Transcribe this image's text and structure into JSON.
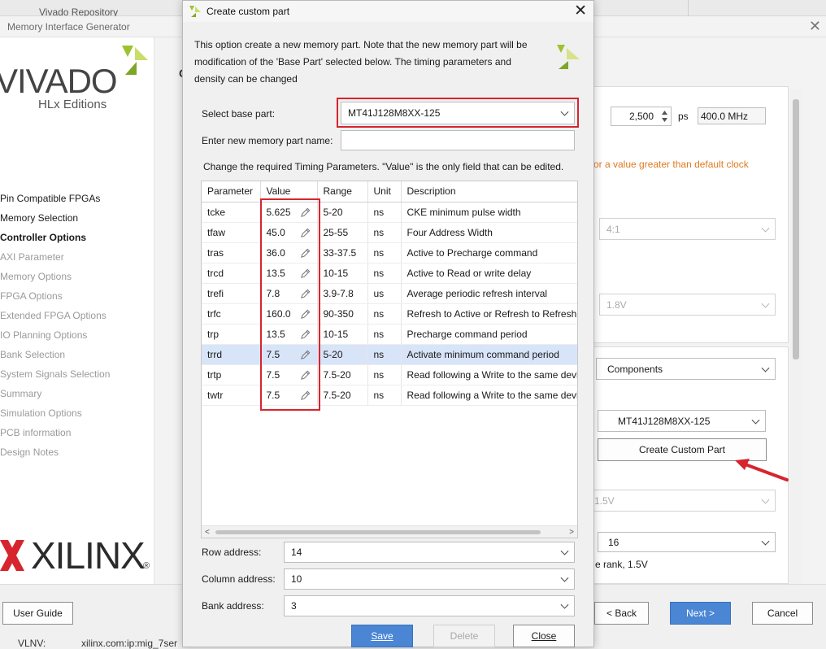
{
  "background": {
    "top_strip_text": "Vivado Repository",
    "window_title": "Memory Interface Generator",
    "brand": {
      "vivado": "VIVADO",
      "hlx": "HLx Editions",
      "xilinx": "XILINX",
      "reg": "®"
    },
    "nav_items": [
      {
        "label": "Pin Compatible FPGAs",
        "state": "active"
      },
      {
        "label": "Memory Selection",
        "state": "active"
      },
      {
        "label": "Controller Options",
        "state": "current"
      },
      {
        "label": "AXI Parameter",
        "state": "inactive"
      },
      {
        "label": "Memory Options",
        "state": "inactive"
      },
      {
        "label": "FPGA Options",
        "state": "inactive"
      },
      {
        "label": "Extended FPGA Options",
        "state": "inactive"
      },
      {
        "label": "IO Planning Options",
        "state": "inactive"
      },
      {
        "label": "Bank Selection",
        "state": "inactive"
      },
      {
        "label": "System Signals Selection",
        "state": "inactive"
      },
      {
        "label": "Summary",
        "state": "inactive"
      },
      {
        "label": "Simulation Options",
        "state": "inactive"
      },
      {
        "label": "PCB information",
        "state": "inactive"
      },
      {
        "label": "Design Notes",
        "state": "inactive"
      }
    ],
    "page_letter": "C",
    "clock_period": "2,500",
    "clock_unit": "ps",
    "clock_freq": "400.0 MHz",
    "clock_warning": "or a value greater than default clock",
    "ratio_value": "4:1",
    "voltage_value": "1.8V",
    "memory_type": "Components",
    "memory_part": "MT41J128M8XX-125",
    "create_custom_part_label": "Create Custom Part",
    "io_voltage": "1.5V",
    "data_width": "16",
    "rank_text": "e rank, 1.5V",
    "user_guide_label": "User Guide",
    "back_label": "< Back",
    "next_label": "Next >",
    "cancel_label": "Cancel",
    "vlnv_label": "VLNV:",
    "vlnv_value": "xilinx.com:ip:mig_7ser",
    "annotation_arrow_color": "#d6252e"
  },
  "dialog": {
    "title": "Create custom part",
    "description": "This option create a new memory part. Note that the new memory part will be modification of the 'Base Part' selected below. The timing parameters and density can be changed",
    "base_part_label": "Select base part:",
    "base_part_value": "MT41J128M8XX-125",
    "new_name_label": "Enter new memory part name:",
    "new_name_value": "",
    "timing_note": "Change the required Timing Parameters. \"Value\" is the only field that can be edited.",
    "columns": [
      "Parameter",
      "Value",
      "Range",
      "Unit",
      "Description"
    ],
    "rows": [
      {
        "parameter": "tcke",
        "value": "5.625",
        "range": "5-20",
        "unit": "ns",
        "description": "CKE minimum pulse width"
      },
      {
        "parameter": "tfaw",
        "value": "45.0",
        "range": "25-55",
        "unit": "ns",
        "description": "Four Address Width"
      },
      {
        "parameter": "tras",
        "value": "36.0",
        "range": "33-37.5",
        "unit": "ns",
        "description": "Active to Precharge command"
      },
      {
        "parameter": "trcd",
        "value": "13.5",
        "range": "10-15",
        "unit": "ns",
        "description": "Active to Read or write delay"
      },
      {
        "parameter": "trefi",
        "value": "7.8",
        "range": "3.9-7.8",
        "unit": "us",
        "description": "Average periodic refresh interval"
      },
      {
        "parameter": "trfc",
        "value": "160.0",
        "range": "90-350",
        "unit": "ns",
        "description": "Refresh to Active or Refresh to Refresh"
      },
      {
        "parameter": "trp",
        "value": "13.5",
        "range": "10-15",
        "unit": "ns",
        "description": "Precharge command period"
      },
      {
        "parameter": "trrd",
        "value": "7.5",
        "range": "5-20",
        "unit": "ns",
        "description": "Activate minimum command period",
        "selected": true
      },
      {
        "parameter": "trtp",
        "value": "7.5",
        "range": "7.5-20",
        "unit": "ns",
        "description": "Read following a Write to the same device"
      },
      {
        "parameter": "twtr",
        "value": "7.5",
        "range": "7.5-20",
        "unit": "ns",
        "description": "Read following a Write to the same device"
      }
    ],
    "row_address_label": "Row address:",
    "row_address_value": "14",
    "column_address_label": "Column address:",
    "column_address_value": "10",
    "bank_address_label": "Bank address:",
    "bank_address_value": "3",
    "save_label": "Save",
    "delete_label": "Delete",
    "close_label": "Close",
    "highlight_color": "#d6252e",
    "selected_row_color": "#d8e4f8",
    "accent_color": "#4a86d4"
  }
}
